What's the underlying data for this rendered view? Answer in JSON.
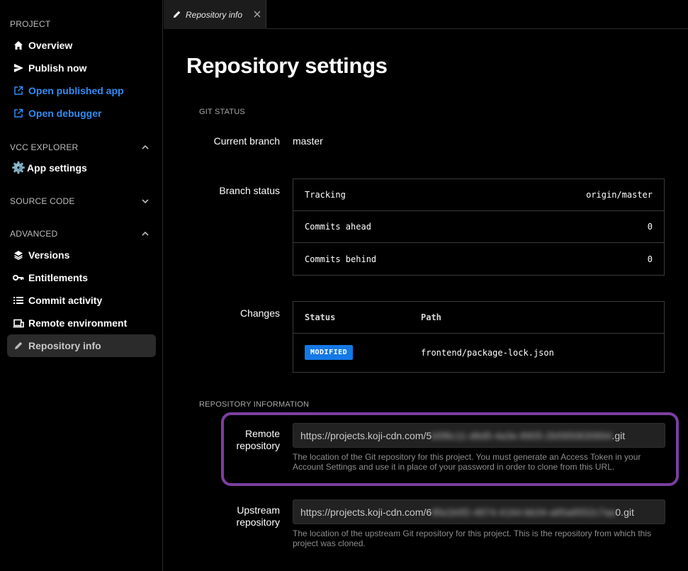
{
  "sidebar": {
    "project_title": "PROJECT",
    "project_items": [
      {
        "label": "Overview",
        "icon": "home-icon"
      },
      {
        "label": "Publish now",
        "icon": "send-icon"
      },
      {
        "label": "Open published app",
        "icon": "external-link-icon"
      },
      {
        "label": "Open debugger",
        "icon": "external-link-icon"
      }
    ],
    "vcc_title": "VCC EXPLORER",
    "vcc_items": [
      {
        "label": "App settings",
        "icon": "gear-icon"
      }
    ],
    "source_title": "SOURCE CODE",
    "advanced_title": "ADVANCED",
    "advanced_items": [
      {
        "label": "Versions",
        "icon": "layers-icon"
      },
      {
        "label": "Entitlements",
        "icon": "key-icon"
      },
      {
        "label": "Commit activity",
        "icon": "list-icon"
      },
      {
        "label": "Remote environment",
        "icon": "laptop-icon"
      },
      {
        "label": "Repository info",
        "icon": "pencil-icon"
      }
    ]
  },
  "tab": {
    "label": "Repository info"
  },
  "page": {
    "title": "Repository settings",
    "git_status_heading": "GIT STATUS",
    "current_branch_label": "Current branch",
    "current_branch_value": "master",
    "branch_status_label": "Branch status",
    "branch_status": [
      {
        "key": "Tracking",
        "value": "origin/master"
      },
      {
        "key": "Commits ahead",
        "value": "0"
      },
      {
        "key": "Commits behind",
        "value": "0"
      }
    ],
    "changes_label": "Changes",
    "changes_headers": {
      "status": "Status",
      "path": "Path"
    },
    "changes_rows": [
      {
        "status": "MODIFIED",
        "path": "frontend/package-lock.json"
      }
    ],
    "repo_info_heading": "REPOSITORY INFORMATION",
    "remote_label": "Remote repository",
    "remote_url_prefix": "https://projects.koji-cdn.com/5",
    "remote_url_blurred": "b5f6c11-d6d5-4a3e-8905-2b5950630694",
    "remote_url_suffix": ".git",
    "remote_help": "The location of the Git repository for this project. You must generate an Access Token in your Account Settings and use it in place of your password in order to clone from this URL.",
    "upstream_label": "Upstream repository",
    "upstream_url_prefix": "https://projects.koji-cdn.com/6",
    "upstream_url_blurred": "8fa1b0f2-4874-4164-bb34-a85a8552c7aa",
    "upstream_url_suffix": "0.git",
    "upstream_help": "The location of the upstream Git repository for this project. This is the repository from which this project was cloned."
  },
  "colors": {
    "accent": "#2f8df5",
    "badge": "#1479e6",
    "highlight": "#7b3fa0",
    "active_item_bg": "#2b2b2b"
  }
}
